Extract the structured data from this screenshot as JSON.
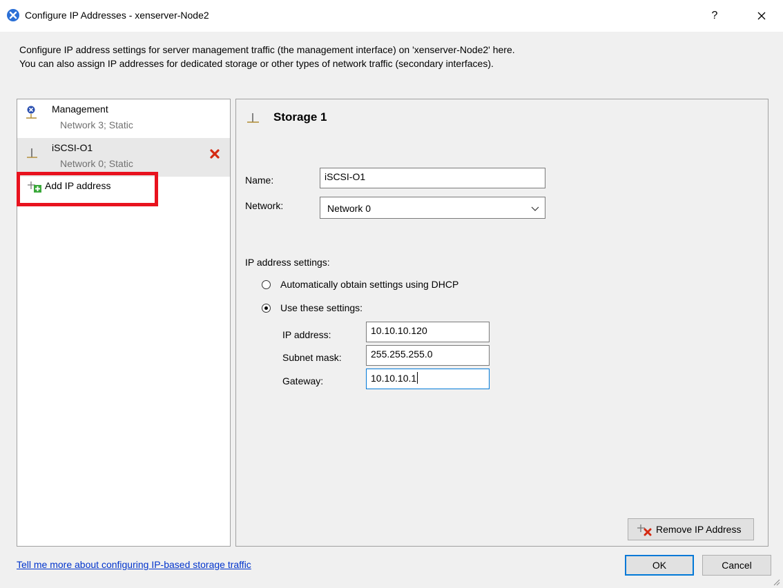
{
  "window": {
    "title": "Configure IP Addresses - xenserver-Node2",
    "help_label": "?"
  },
  "description": {
    "line1": "Configure IP address settings for server management traffic (the management interface) on 'xenserver-Node2' here.",
    "line2": "You can also assign IP addresses for dedicated storage or other types of network traffic (secondary interfaces)."
  },
  "interfaces": [
    {
      "name": "Management",
      "sub": "Network 3; Static",
      "icon": "management-icon"
    },
    {
      "name": "iSCSI-O1",
      "sub": "Network 0; Static",
      "icon": "interface-icon",
      "selected": true
    }
  ],
  "add_ip_label": "Add IP address",
  "detail": {
    "title": "Storage 1",
    "name_label": "Name:",
    "name_value": "iSCSI-O1",
    "network_label": "Network:",
    "network_value": "Network 0",
    "ip_settings_label": "IP address settings:",
    "dhcp_label": "Automatically obtain settings using DHCP",
    "static_label": "Use these settings:",
    "ip_label": "IP address:",
    "ip_value": "10.10.10.120",
    "mask_label": "Subnet mask:",
    "mask_value": "255.255.255.0",
    "gateway_label": "Gateway:",
    "gateway_value": "10.10.10.1",
    "selected_mode": "static",
    "remove_label": "Remove IP Address"
  },
  "footer": {
    "help_link": "Tell me more about configuring IP-based storage traffic",
    "ok_label": "OK",
    "cancel_label": "Cancel"
  },
  "colors": {
    "highlight": "#e8121e",
    "link": "#0033cc",
    "focus": "#0078d7"
  }
}
